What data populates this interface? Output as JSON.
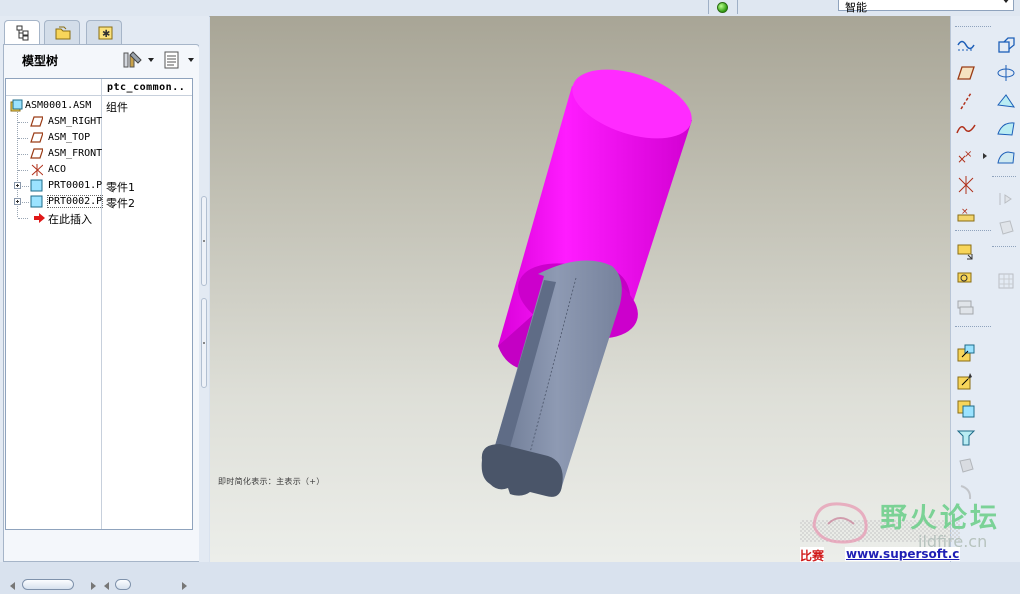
{
  "topbar": {
    "filter_value": "智能",
    "status_color": "#2f9b12"
  },
  "navigator": {
    "tabs": [
      {
        "icon": "model-tree-icon",
        "active": true
      },
      {
        "icon": "folder-browser-icon",
        "active": false
      },
      {
        "icon": "favorites-icon",
        "active": false
      }
    ],
    "title": "模型树",
    "settings_icon": "tree-settings-icon",
    "show_icon": "tree-show-icon",
    "column_header": "ptc_common..",
    "items": [
      {
        "name": "ASM0001.ASM",
        "col2": "组件",
        "icon": "assembly-icon",
        "expandable": false
      },
      {
        "name": "ASM_RIGHT",
        "col2": "",
        "icon": "datum-plane-icon",
        "expandable": false
      },
      {
        "name": "ASM_TOP",
        "col2": "",
        "icon": "datum-plane-icon",
        "expandable": false
      },
      {
        "name": "ASM_FRONT",
        "col2": "",
        "icon": "datum-plane-icon",
        "expandable": false
      },
      {
        "name": "ACO",
        "col2": "",
        "icon": "coordinate-system-icon",
        "expandable": false
      },
      {
        "name": "PRT0001.P",
        "col2": "零件1",
        "icon": "part-icon",
        "expandable": true
      },
      {
        "name": "PRT0002.P",
        "col2": "零件2",
        "icon": "part-icon",
        "expandable": true
      },
      {
        "name": "在此插入",
        "col2": "",
        "icon": "insert-here-arrow-icon",
        "expandable": false
      }
    ]
  },
  "graphics": {
    "message": "即时简化表示：主表示（+）",
    "colors": {
      "sleeve": "#ff00ff",
      "shaft": "#7f8ba4",
      "background_top": "#a8a596",
      "background_bottom": "#eceeea"
    }
  },
  "right_toolbar": {
    "tools": [
      "sketch-tool-icon",
      "datum-plane-tool-icon",
      "datum-axis-tool-icon",
      "datum-curve-tool-icon",
      "datum-point-tool-icon",
      "coordinate-system-tool-icon",
      "analysis-feature-icon",
      "assemble-component-icon",
      "create-component-icon",
      "repeat-component-icon",
      "pull-component-icon",
      "package-component-icon",
      "copy-geometry-icon",
      "shrinkwrap-icon",
      "explode-view-icon",
      "hole-tool-icon",
      "revolve-tool-icon",
      "sweep-tool-icon",
      "boundary-blend-icon",
      "style-tool-icon",
      "round-tool-icon",
      "chamfer-tool-icon",
      "mirror-tool-icon",
      "pattern-tool-icon"
    ]
  },
  "watermark": {
    "forum_name": "野火论坛",
    "domain": "ildfire.cn",
    "url": "www.supersoft.c",
    "left_text": "比赛"
  }
}
